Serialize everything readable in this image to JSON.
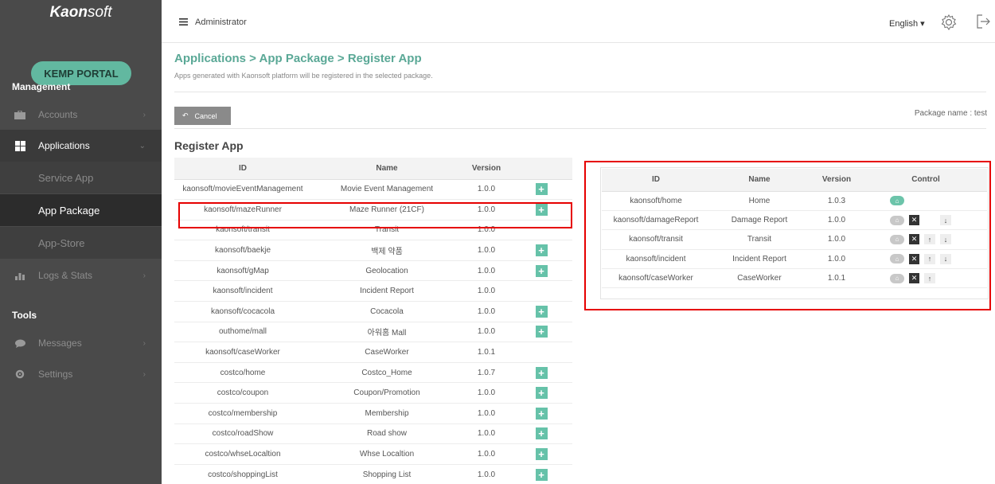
{
  "sidebar": {
    "logo_bold": "Kaon",
    "logo_light": "soft",
    "portal_label": "KEMP PORTAL",
    "management_title": "Management",
    "tools_title": "Tools",
    "items": [
      {
        "label": "Accounts",
        "icon": "briefcase-icon"
      },
      {
        "label": "Applications",
        "icon": "grid-icon"
      },
      {
        "label": "Logs & Stats",
        "icon": "bar-chart-icon"
      },
      {
        "label": "Messages",
        "icon": "chat-bubble-icon"
      },
      {
        "label": "Settings",
        "icon": "gear-icon"
      }
    ],
    "sub_items": [
      "Service App",
      "App Package",
      "App-Store"
    ]
  },
  "topbar": {
    "user": "Administrator",
    "language": "English"
  },
  "page": {
    "breadcrumb": "Applications > App Package > Register App",
    "description": "Apps generated with Kaonsoft platform will be registered in the selected package.",
    "cancel_label": "Cancel",
    "package_name": "Package name : test",
    "section_title": "Register App"
  },
  "left_table": {
    "headers": [
      "ID",
      "Name",
      "Version"
    ],
    "rows": [
      {
        "id": "kaonsoft/movieEventManagement",
        "name": "Movie Event Management",
        "version": "1.0.0",
        "add": true
      },
      {
        "id": "kaonsoft/mazeRunner",
        "name": "Maze Runner (21CF)",
        "version": "1.0.0",
        "add": true
      },
      {
        "id": "kaonsoft/transit",
        "name": "Transit",
        "version": "1.0.0",
        "add": false
      },
      {
        "id": "kaonsoft/baekje",
        "name": "백제 약품",
        "version": "1.0.0",
        "add": true
      },
      {
        "id": "kaonsoft/gMap",
        "name": "Geolocation",
        "version": "1.0.0",
        "add": true
      },
      {
        "id": "kaonsoft/incident",
        "name": "Incident Report",
        "version": "1.0.0",
        "add": false
      },
      {
        "id": "kaonsoft/cocacola",
        "name": "Cocacola",
        "version": "1.0.0",
        "add": true
      },
      {
        "id": "outhome/mall",
        "name": "아워홈 Mall",
        "version": "1.0.0",
        "add": true
      },
      {
        "id": "kaonsoft/caseWorker",
        "name": "CaseWorker",
        "version": "1.0.1",
        "add": false
      },
      {
        "id": "costco/home",
        "name": "Costco_Home",
        "version": "1.0.7",
        "add": true
      },
      {
        "id": "costco/coupon",
        "name": "Coupon/Promotion",
        "version": "1.0.0",
        "add": true
      },
      {
        "id": "costco/membership",
        "name": "Membership",
        "version": "1.0.0",
        "add": true
      },
      {
        "id": "costco/roadShow",
        "name": "Road show",
        "version": "1.0.0",
        "add": true
      },
      {
        "id": "costco/whseLocaltion",
        "name": "Whse Localtion",
        "version": "1.0.0",
        "add": true
      },
      {
        "id": "costco/shoppingList",
        "name": "Shopping List",
        "version": "1.0.0",
        "add": true
      }
    ]
  },
  "right_table": {
    "headers": [
      "ID",
      "Name",
      "Version",
      "Control"
    ],
    "rows": [
      {
        "id": "kaonsoft/home",
        "name": "Home",
        "version": "1.0.3",
        "home_active": true,
        "remove": false,
        "up": false,
        "down": false
      },
      {
        "id": "kaonsoft/damageReport",
        "name": "Damage Report",
        "version": "1.0.0",
        "home_active": false,
        "remove": true,
        "up": false,
        "down": true
      },
      {
        "id": "kaonsoft/transit",
        "name": "Transit",
        "version": "1.0.0",
        "home_active": false,
        "remove": true,
        "up": true,
        "down": true
      },
      {
        "id": "kaonsoft/incident",
        "name": "Incident Report",
        "version": "1.0.0",
        "home_active": false,
        "remove": true,
        "up": true,
        "down": true
      },
      {
        "id": "kaonsoft/caseWorker",
        "name": "CaseWorker",
        "version": "1.0.1",
        "home_active": false,
        "remove": true,
        "up": true,
        "down": false
      }
    ]
  },
  "colors": {
    "accent": "#5aa896",
    "highlight": "#e60000",
    "sidebar_bg": "#4a4a4a"
  }
}
